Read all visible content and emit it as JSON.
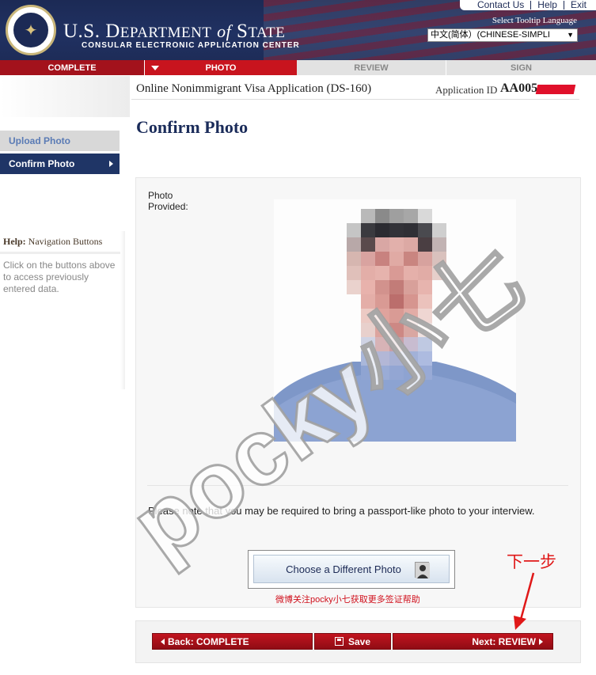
{
  "header": {
    "seal_text": "DEPARTMENT OF STATE",
    "brand_name": "U.S. Department of State",
    "brand_prefix": "U.S. ",
    "brand_d": "D",
    "brand_epartment": "EPARTMENT",
    "brand_of": "of",
    "brand_s": "S",
    "brand_tate": "TATE",
    "subtitle": "CONSULAR ELECTRONIC APPLICATION CENTER",
    "top_links": [
      "Contact Us",
      "Help",
      "Exit"
    ],
    "tooltip_language_label": "Select Tooltip Language",
    "language_selected": "中文(简体）(CHINESE-SIMPLI"
  },
  "tabs": [
    {
      "label": "COMPLETE"
    },
    {
      "label": "PHOTO"
    },
    {
      "label": "REVIEW"
    },
    {
      "label": "SIGN"
    }
  ],
  "application": {
    "title": "Online Nonimmigrant Visa Application (DS-160)",
    "id_label": "Application ID",
    "id_value": "AA005"
  },
  "page_title": "Confirm Photo",
  "sidebar": {
    "items": [
      {
        "label": "Upload Photo"
      },
      {
        "label": "Confirm Photo"
      }
    ],
    "help_title_bold": "Help:",
    "help_title_rest": "Navigation Buttons",
    "help_body": "Click on the buttons above to access previously entered data."
  },
  "main": {
    "photo_label": "Photo Provided:",
    "note": "Please note that you may be required to bring a passport-like photo to your interview.",
    "choose_button": "Choose a Different Photo",
    "weibo_note": "微博关注pocky小七获取更多签证帮助",
    "annotation_next": "下一步"
  },
  "watermark": "pocky小七",
  "bottom_nav": {
    "back": "Back: COMPLETE",
    "save": "Save",
    "next": "Next: REVIEW"
  },
  "colors": {
    "navy": "#1c2a55",
    "tab_red": "#c8141e",
    "annotation_red": "#e01818"
  }
}
